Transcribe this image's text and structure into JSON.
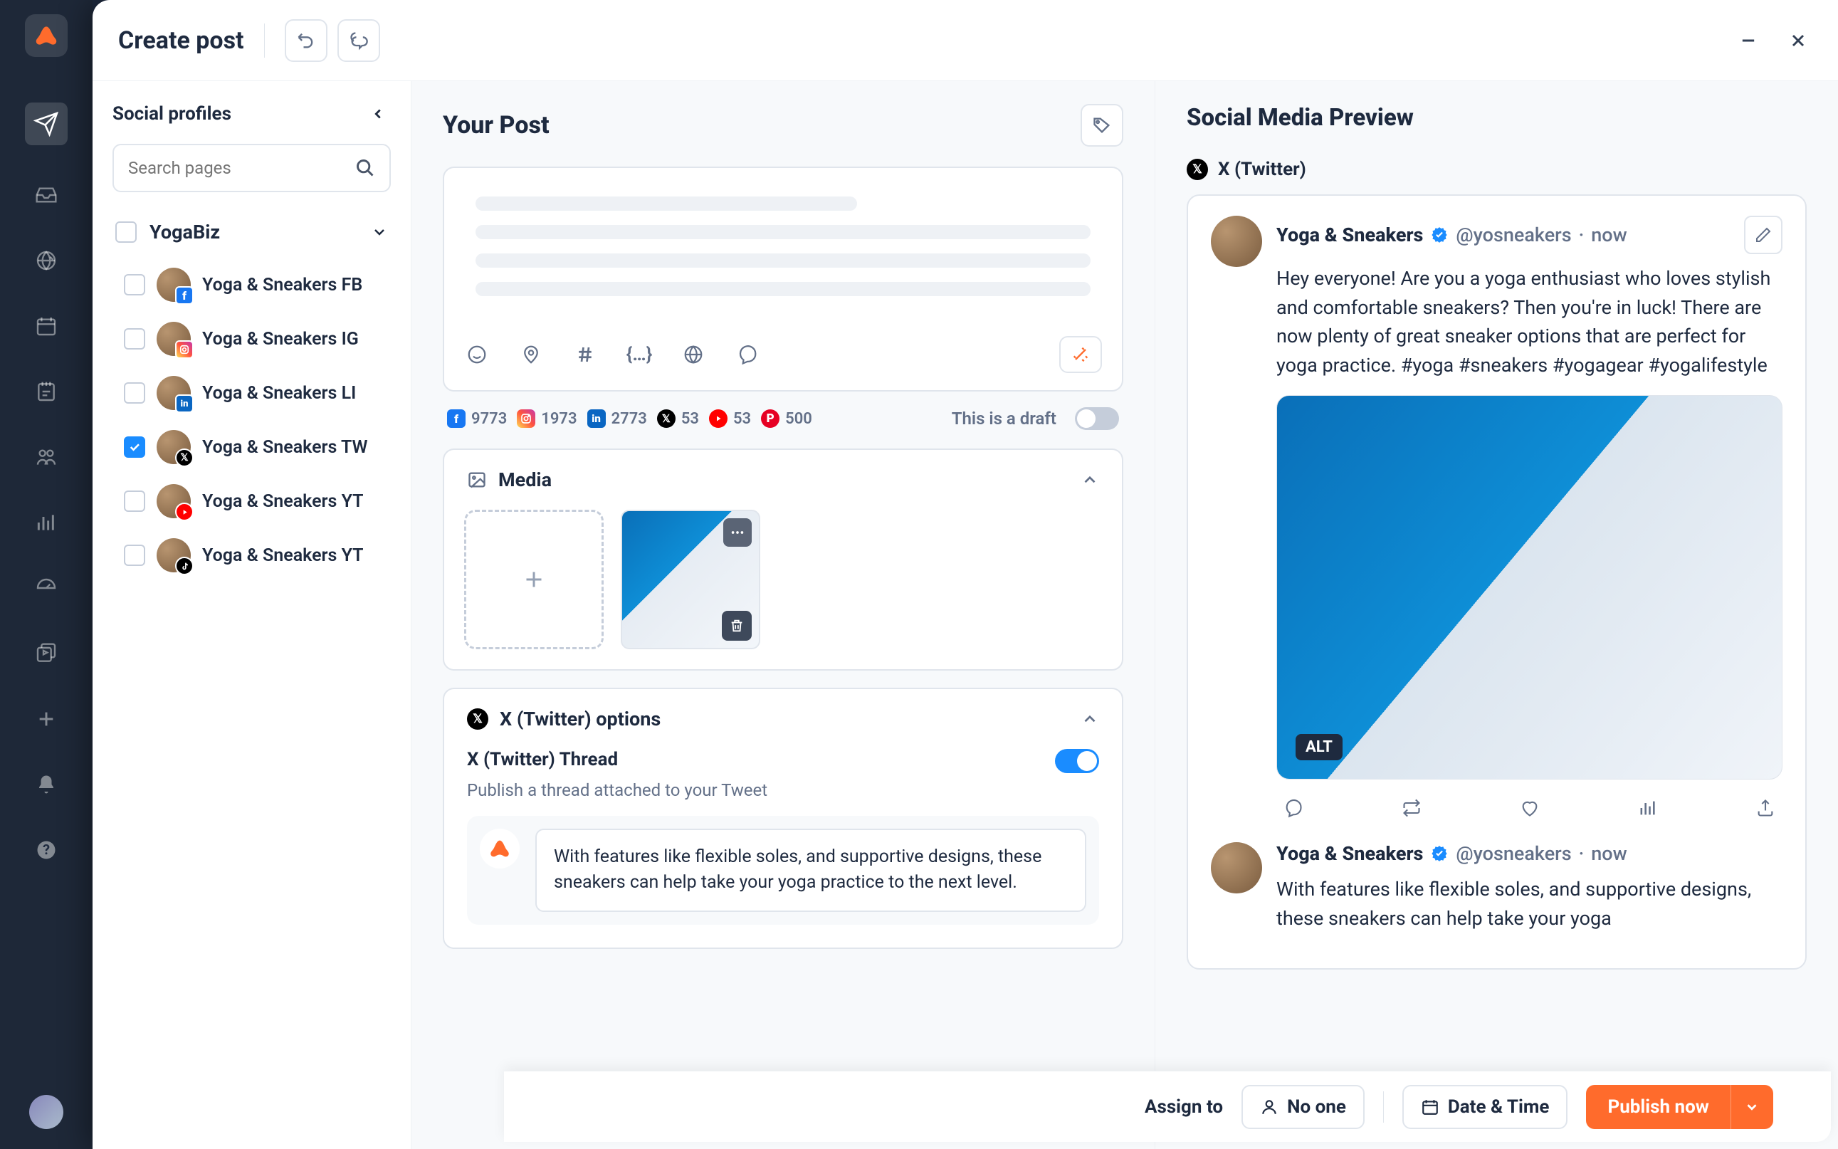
{
  "header": {
    "title": "Create post"
  },
  "profiles_panel": {
    "title": "Social profiles",
    "search_placeholder": "Search pages",
    "group_name": "YogaBiz",
    "profiles": [
      {
        "label": "Yoga & Sneakers FB",
        "network": "facebook",
        "checked": false
      },
      {
        "label": "Yoga & Sneakers IG",
        "network": "instagram",
        "checked": false
      },
      {
        "label": "Yoga & Sneakers LI",
        "network": "linkedin",
        "checked": false
      },
      {
        "label": "Yoga & Sneakers TW",
        "network": "twitter",
        "checked": true
      },
      {
        "label": "Yoga & Sneakers YT",
        "network": "youtube",
        "checked": false
      },
      {
        "label": "Yoga & Sneakers YT",
        "network": "tiktok",
        "checked": false
      }
    ]
  },
  "composer": {
    "title": "Your Post",
    "media_title": "Media",
    "options_title": "X (Twitter) options",
    "thread_title": "X (Twitter) Thread",
    "thread_desc": "Publish a thread attached to your Tweet",
    "thread_entry_text": "With features like flexible soles, and supportive designs, these sneakers can help take your yoga practice to the next level.",
    "draft_label": "This is a draft",
    "counters": {
      "facebook": "9773",
      "instagram": "1973",
      "linkedin": "2773",
      "twitter": "53",
      "youtube": "53",
      "pinterest": "500"
    }
  },
  "preview": {
    "title": "Social Media Preview",
    "network_label": "X (Twitter)",
    "alt_badge": "ALT",
    "tweet1": {
      "name": "Yoga & Sneakers",
      "handle": "@yosneakers",
      "time": "now",
      "text": "Hey everyone! Are you a yoga enthusiast who loves stylish and comfortable sneakers? Then you're in luck! There are now plenty of great sneaker options that are perfect for yoga practice. #yoga #sneakers #yogagear #yogalifestyle"
    },
    "tweet2": {
      "name": "Yoga & Sneakers",
      "handle": "@yosneakers",
      "time": "now",
      "text": "With features like flexible soles, and supportive designs, these sneakers can help take your yoga"
    }
  },
  "footer": {
    "assign_label": "Assign to",
    "no_one_label": "No one",
    "datetime_label": "Date & Time",
    "publish_label": "Publish now"
  },
  "colors": {
    "facebook": "#1877f2",
    "instagram": "#e4405f",
    "linkedin": "#0a66c2",
    "twitter": "#000000",
    "youtube": "#ff0000",
    "tiktok": "#000000",
    "pinterest": "#e60023",
    "accent": "#ff6b2c",
    "primary_blue": "#1a8cff"
  }
}
